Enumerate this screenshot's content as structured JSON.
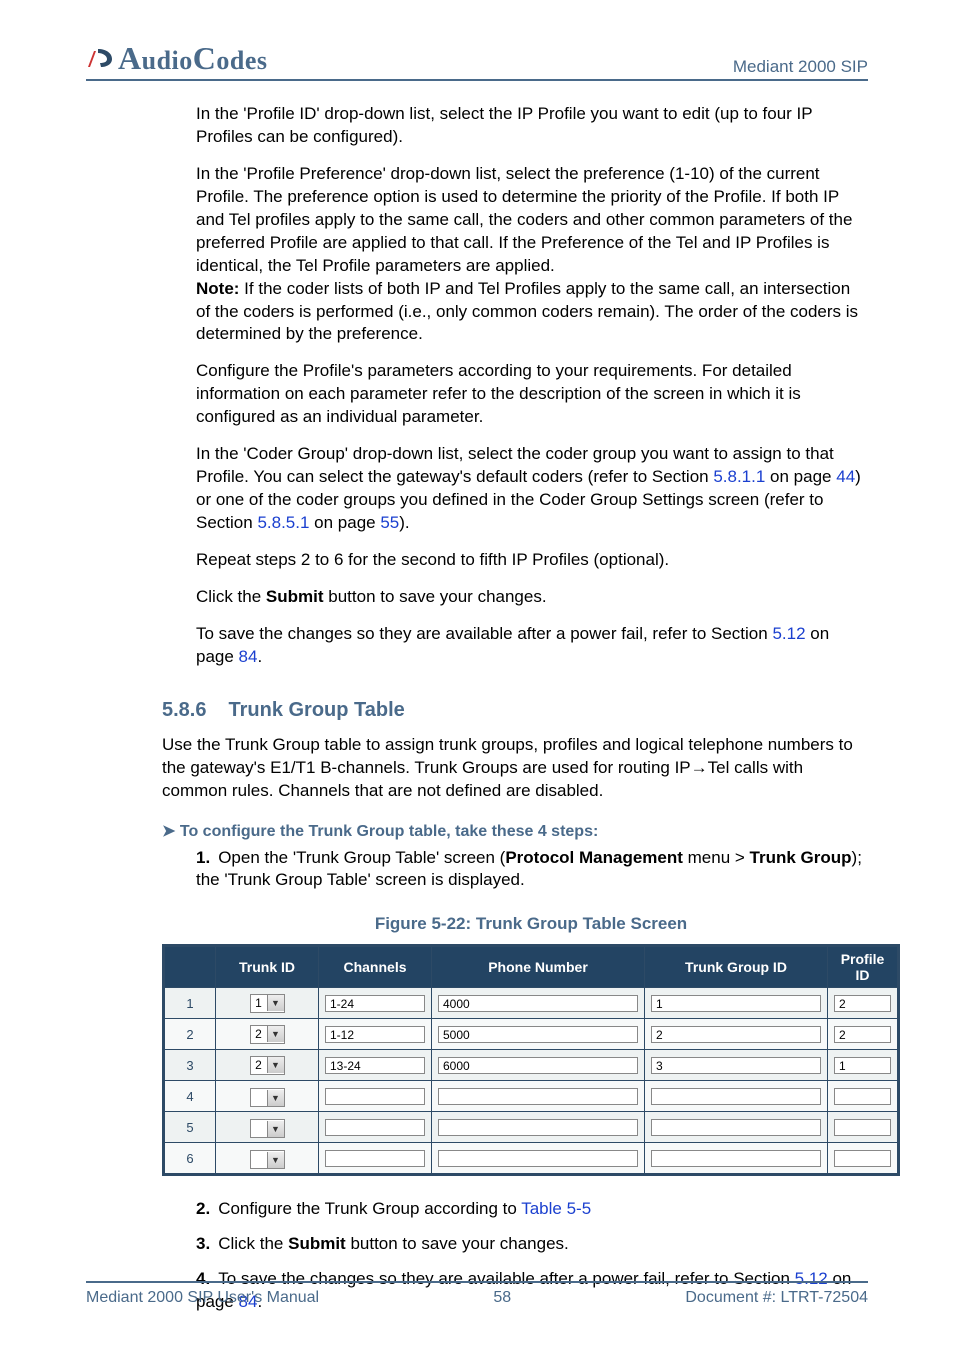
{
  "header": {
    "logo_text": "AudioCodes",
    "right": "Mediant 2000 SIP"
  },
  "body": {
    "p1": "In the 'Profile ID' drop-down list, select the IP Profile you want to edit (up to four IP Profiles can be configured).",
    "p2a": "In the 'Profile Preference' drop-down list, select the preference (1-10) of the current Profile. The preference option is used to determine the priority of the Profile. If both IP and Tel profiles apply to the same call, the coders and other common parameters of the preferred Profile are applied to that call. If the Preference of the Tel and IP Profiles is identical, the Tel Profile parameters are applied.",
    "p2b_label": "Note:",
    "p2b": " If the coder lists of both IP and Tel Profiles apply to the same call, an intersection of the coders is performed (i.e., only common coders remain). The order of the coders is determined by the preference.",
    "p3": "Configure the Profile's parameters according to your requirements. For detailed information on each parameter refer to the description of the screen in which it is configured as an individual parameter.",
    "p4_a": "In the 'Coder Group' drop-down list, select the coder group you want to assign to that Profile. You can select the gateway's default coders (refer to Section ",
    "p4_link1": "5.8.1.1",
    "p4_b": " on page ",
    "p4_link2": "44",
    "p4_c": ") or one of the coder groups you defined in the Coder Group Settings screen (refer to Section ",
    "p4_link3": "5.8.5.1",
    "p4_d": " on page ",
    "p4_link4": "55",
    "p4_e": ").",
    "p5": "Repeat steps 2 to 6 for the second to fifth IP Profiles (optional).",
    "p6_a": "Click the ",
    "p6_bold": "Submit",
    "p6_b": " button to save your changes.",
    "p7_a": "To save the changes so they are available after a power fail, refer to Section ",
    "p7_link1": "5.12",
    "p7_b": " on page ",
    "p7_link2": "84",
    "p7_c": "."
  },
  "section": {
    "num": "5.8.6",
    "title": "Trunk Group Table",
    "desc": "Use the Trunk Group table to assign trunk groups, profiles and logical telephone numbers to the gateway's E1/T1 B-channels. Trunk Groups are used for routing IP→Tel calls with common rules. Channels that are not defined are disabled.",
    "task": "To configure the Trunk Group table, take these 4 steps:",
    "s1a": "Open the 'Trunk Group Table' screen (",
    "s1b": "Protocol Management",
    "s1c": " menu > ",
    "s1d": "Trunk Group",
    "s1e": "); the 'Trunk Group Table' screen is displayed."
  },
  "figure_caption": "Figure 5-22: Trunk Group Table Screen",
  "table": {
    "headers": [
      "",
      "Trunk ID",
      "Channels",
      "Phone Number",
      "Trunk Group ID",
      "Profile ID"
    ],
    "rows": [
      {
        "n": "1",
        "trunk": "1",
        "ch": "1-24",
        "ph": "4000",
        "tg": "1",
        "pid": "2"
      },
      {
        "n": "2",
        "trunk": "2",
        "ch": "1-12",
        "ph": "5000",
        "tg": "2",
        "pid": "2"
      },
      {
        "n": "3",
        "trunk": "2",
        "ch": "13-24",
        "ph": "6000",
        "tg": "3",
        "pid": "1"
      },
      {
        "n": "4",
        "trunk": "",
        "ch": "",
        "ph": "",
        "tg": "",
        "pid": ""
      },
      {
        "n": "5",
        "trunk": "",
        "ch": "",
        "ph": "",
        "tg": "",
        "pid": ""
      },
      {
        "n": "6",
        "trunk": "",
        "ch": "",
        "ph": "",
        "tg": "",
        "pid": ""
      }
    ]
  },
  "after": {
    "s2a": "Configure the Trunk Group according to ",
    "s2link": "Table 5-5",
    "s3a": "Click the ",
    "s3bold": "Submit",
    "s3b": " button to save your changes.",
    "s4a": "To save the changes so they are available after a power fail, refer to Section ",
    "s4link1": "5.12",
    "s4b": " on page ",
    "s4link2": "84",
    "s4c": "."
  },
  "footer": {
    "left": "Mediant 2000 SIP User's Manual",
    "center": "58",
    "right": "Document #: LTRT-72504"
  }
}
